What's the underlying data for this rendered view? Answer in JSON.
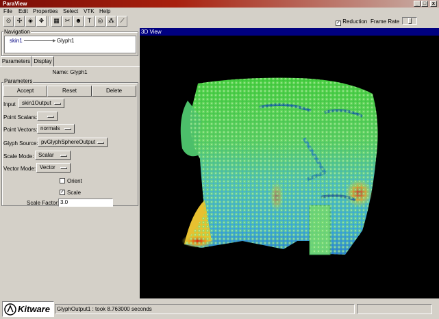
{
  "window": {
    "title": "ParaView",
    "minimize": "_",
    "maximize": "□",
    "close": "x"
  },
  "menu": [
    "File",
    "Edit",
    "Properties",
    "Select",
    "VTK",
    "Help"
  ],
  "toolbar": {
    "reduction_label": "Reduction",
    "reduction_checked": true,
    "frame_rate_label": "Frame Rate"
  },
  "navigation": {
    "label": "Navigation",
    "source": "skin1",
    "target": "Glyph1"
  },
  "tabs": [
    "Parameters",
    "Display"
  ],
  "parameters": {
    "name_line": "Name: Glyph1",
    "group_label": "Parameters",
    "accept": "Accept",
    "reset": "Reset",
    "delete": "Delete",
    "input_label": "Input",
    "input_value": "skin1Output",
    "point_scalars_label": "Point Scalars:",
    "point_scalars_value": "",
    "point_vectors_label": "Point Vectors:",
    "point_vectors_value": "normals",
    "glyph_source_label": "Glyph Source:",
    "glyph_source_value": "pvGlyphSphereOutput",
    "scale_mode_label": "Scale Mode:",
    "scale_mode_value": "Scalar",
    "vector_mode_label": "Vector Mode:",
    "vector_mode_value": "Vector",
    "orient_label": "Orient",
    "orient_checked": false,
    "scale_label": "Scale",
    "scale_checked": true,
    "scale_factor_label": "Scale Factor:",
    "scale_factor_value": "3.0"
  },
  "view": {
    "title": "3D View",
    "background": "#000000"
  },
  "status": {
    "logo_text": "Kitware",
    "message": "GlyphOutput1 : took 8.763000 seconds"
  },
  "colors": {
    "title_bar": "#7b0e07",
    "view_header": "#000080",
    "chrome": "#d4d0c8"
  }
}
